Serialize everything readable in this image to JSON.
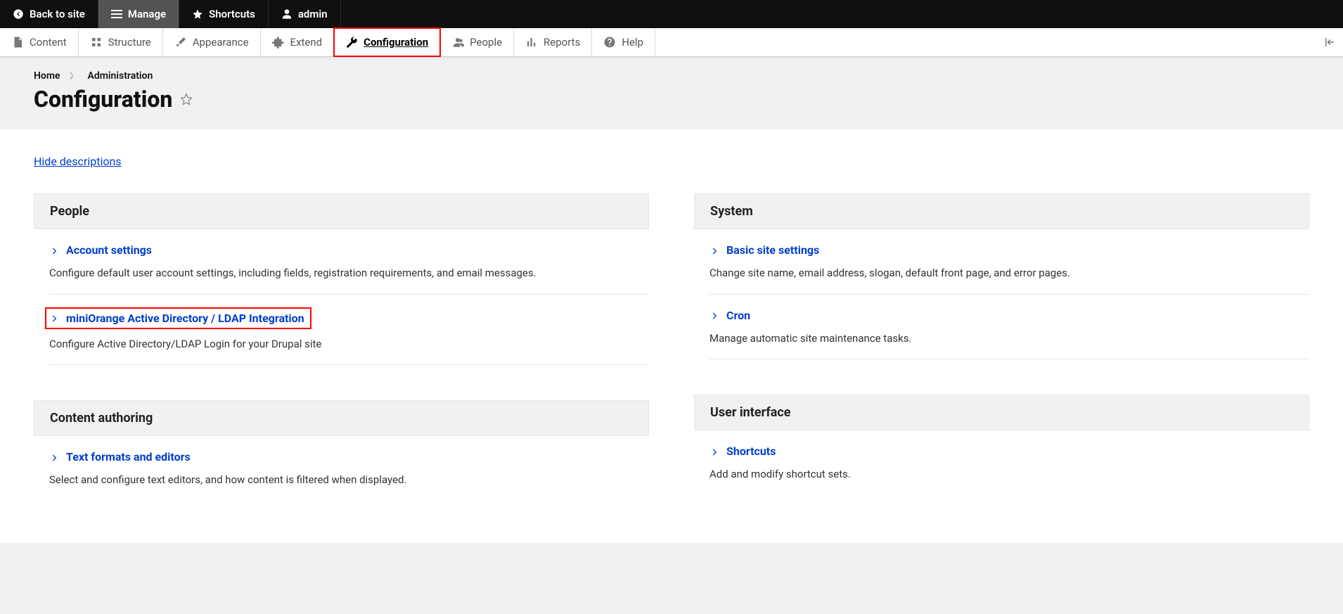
{
  "toolbar": {
    "back": "Back to site",
    "manage": "Manage",
    "shortcuts": "Shortcuts",
    "admin": "admin"
  },
  "admin_menu": {
    "content": "Content",
    "structure": "Structure",
    "appearance": "Appearance",
    "extend": "Extend",
    "configuration": "Configuration",
    "people": "People",
    "reports": "Reports",
    "help": "Help"
  },
  "breadcrumb": {
    "home": "Home",
    "administration": "Administration"
  },
  "page_title": "Configuration",
  "hide_descriptions": "Hide descriptions",
  "left": {
    "people": {
      "title": "People",
      "items": [
        {
          "label": "Account settings",
          "desc": "Configure default user account settings, including fields, registration requirements, and email messages."
        },
        {
          "label": "miniOrange Active Directory / LDAP Integration",
          "desc": "Configure Active Directory/LDAP Login for your Drupal site"
        }
      ]
    },
    "content_authoring": {
      "title": "Content authoring",
      "items": [
        {
          "label": "Text formats and editors",
          "desc": "Select and configure text editors, and how content is filtered when displayed."
        }
      ]
    }
  },
  "right": {
    "system": {
      "title": "System",
      "items": [
        {
          "label": "Basic site settings",
          "desc": "Change site name, email address, slogan, default front page, and error pages."
        },
        {
          "label": "Cron",
          "desc": "Manage automatic site maintenance tasks."
        }
      ]
    },
    "ui": {
      "title": "User interface",
      "items": [
        {
          "label": "Shortcuts",
          "desc": "Add and modify shortcut sets."
        }
      ]
    }
  }
}
